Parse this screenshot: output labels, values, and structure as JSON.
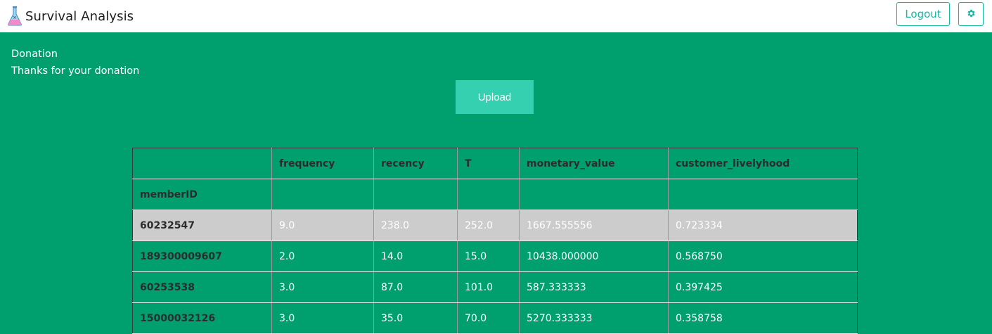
{
  "app": {
    "title": "Survival Analysis"
  },
  "header": {
    "logout_label": "Logout",
    "settings_icon": "gear-icon",
    "brand_icon": "flask-icon"
  },
  "main": {
    "donation_title": "Donation",
    "donation_message": "Thanks for your donation",
    "upload_label": "Upload"
  },
  "table": {
    "columns": [
      "",
      "frequency",
      "recency",
      "T",
      "monetary_value",
      "customer_livelyhood"
    ],
    "index_label": "memberID",
    "rows": [
      {
        "id": "60232547",
        "frequency": "9.0",
        "recency": "238.0",
        "T": "252.0",
        "monetary_value": "1667.555556",
        "customer_livelyhood": "0.723334"
      },
      {
        "id": "189300009607",
        "frequency": "2.0",
        "recency": "14.0",
        "T": "15.0",
        "monetary_value": "10438.000000",
        "customer_livelyhood": "0.568750"
      },
      {
        "id": "60253538",
        "frequency": "3.0",
        "recency": "87.0",
        "T": "101.0",
        "monetary_value": "587.333333",
        "customer_livelyhood": "0.397425"
      },
      {
        "id": "15000032126",
        "frequency": "3.0",
        "recency": "35.0",
        "T": "70.0",
        "monetary_value": "5270.333333",
        "customer_livelyhood": "0.358758"
      }
    ]
  },
  "colors": {
    "background": "#00a06e",
    "accent": "#13b8a0",
    "upload_button": "#35d0b0",
    "highlight_row": "#cccccc"
  }
}
